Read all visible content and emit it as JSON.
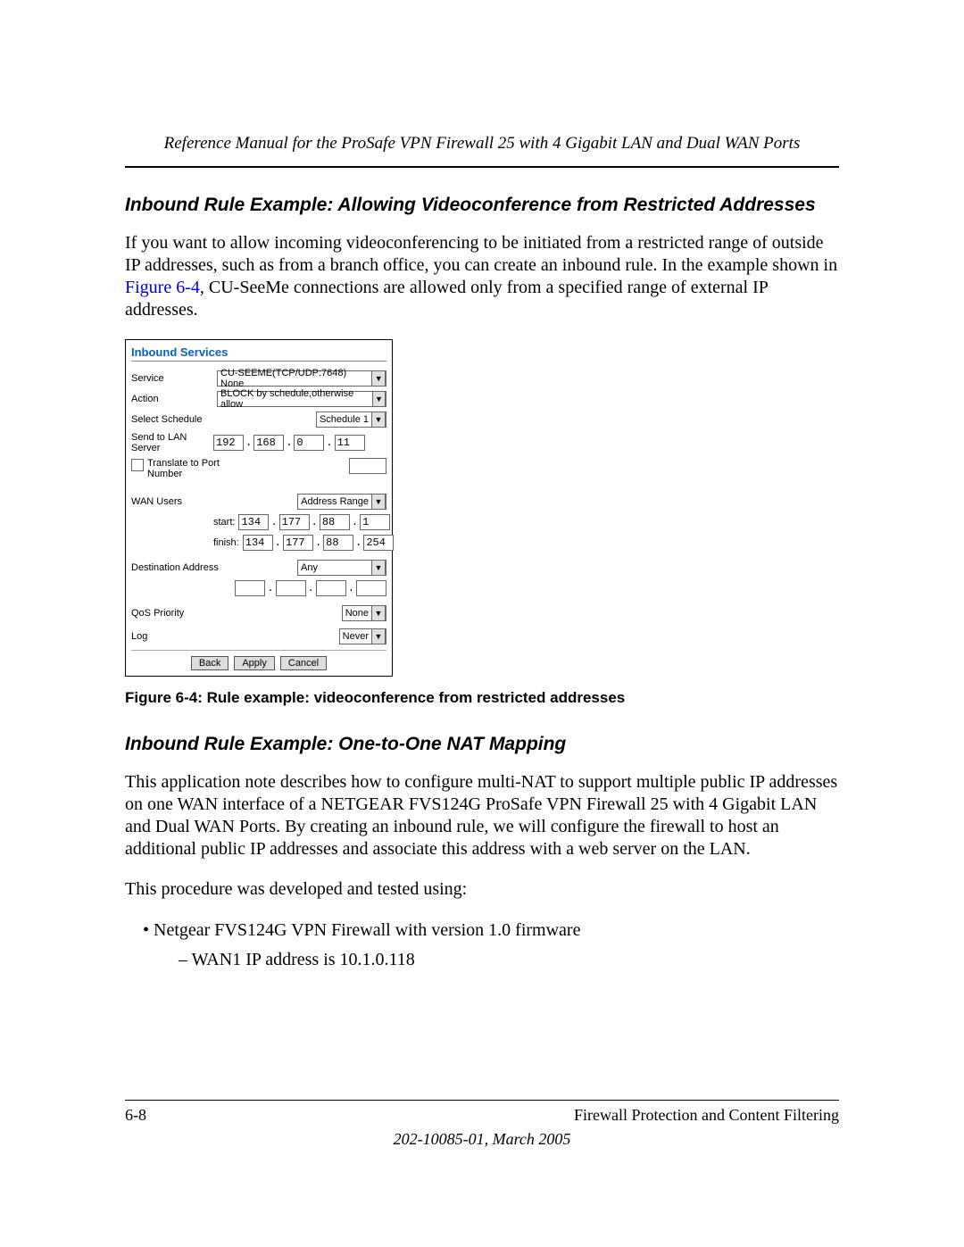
{
  "header_title": "Reference Manual for the ProSafe VPN Firewall 25 with 4 Gigabit LAN and Dual WAN Ports",
  "section1": {
    "heading": "Inbound Rule Example: Allowing Videoconference from Restricted Addresses",
    "para_a": "If you want to allow incoming videoconferencing to be initiated from a restricted range of outside IP addresses, such as from a branch office, you can create an inbound rule. In the example shown in ",
    "figref": "Figure 6-4",
    "para_b": ", CU-SeeMe connections are allowed only from a specified range of external IP addresses."
  },
  "panel": {
    "title": "Inbound Services",
    "rows": {
      "service": {
        "label": "Service",
        "value": "CU-SEEME(TCP/UDP:7648) None"
      },
      "action": {
        "label": "Action",
        "value": "BLOCK by schedule,otherwise allow"
      },
      "schedule": {
        "label": "Select Schedule",
        "value": "Schedule 1"
      },
      "send_lan": {
        "label": "Send to LAN Server",
        "ip": [
          "192",
          "168",
          "0",
          "11"
        ]
      },
      "translate": {
        "label": "Translate to Port Number"
      },
      "wan_users": {
        "label": "WAN Users",
        "value": "Address Range"
      },
      "range_start": {
        "label": "start:",
        "ip": [
          "134",
          "177",
          "88",
          "1"
        ]
      },
      "range_finish": {
        "label": "finish:",
        "ip": [
          "134",
          "177",
          "88",
          "254"
        ]
      },
      "dest": {
        "label": "Destination Address",
        "value": "Any"
      },
      "qos": {
        "label": "QoS Priority",
        "value": "None"
      },
      "log": {
        "label": "Log",
        "value": "Never"
      }
    },
    "buttons": {
      "back": "Back",
      "apply": "Apply",
      "cancel": "Cancel"
    }
  },
  "caption": "Figure 6-4:  Rule example: videoconference from restricted addresses",
  "section2": {
    "heading": "Inbound Rule Example: One-to-One NAT Mapping",
    "para": "This application note describes how to configure multi-NAT to support multiple public IP addresses on one WAN interface of a NETGEAR FVS124G ProSafe VPN Firewall 25 with 4 Gigabit LAN and Dual WAN Ports.  By creating an inbound rule, we will configure the firewall to host an additional public IP addresses and associate this address with a web server on the LAN.",
    "para2": "This procedure was developed and tested using:",
    "bullet1": "Netgear FVS124G VPN Firewall with version 1.0 firmware",
    "sub1": "WAN1 IP address is    10.1.0.118"
  },
  "footer": {
    "left": "6-8",
    "right": "Firewall Protection and Content Filtering",
    "center": "202-10085-01, March 2005"
  }
}
